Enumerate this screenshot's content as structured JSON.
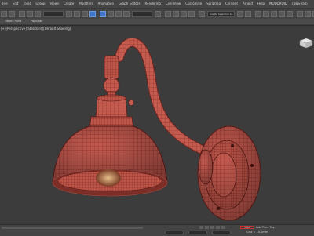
{
  "menu": [
    "File",
    "Edit",
    "Tools",
    "Group",
    "Views",
    "Create",
    "Modifiers",
    "Animation",
    "Graph Editors",
    "Rendering",
    "Civil View",
    "Customize",
    "Scripting",
    "Content",
    "Arnold",
    "Help",
    "MODDROID",
    "rawSTrain"
  ],
  "toolbar": {
    "selection_set": "Create Selection Se"
  },
  "ribbon": [
    "Object Paint",
    "Populate"
  ],
  "viewport": {
    "label": "[+][Perspective][Standard][Default Shading]"
  },
  "status": {
    "grid": "Grid = 10.0mm",
    "autokey": "Auto",
    "add_time_tag": "Add Time Tag"
  },
  "colors": {
    "model": "#c85a50",
    "wire": "#5e1c18",
    "background": "#3c3c3c"
  }
}
